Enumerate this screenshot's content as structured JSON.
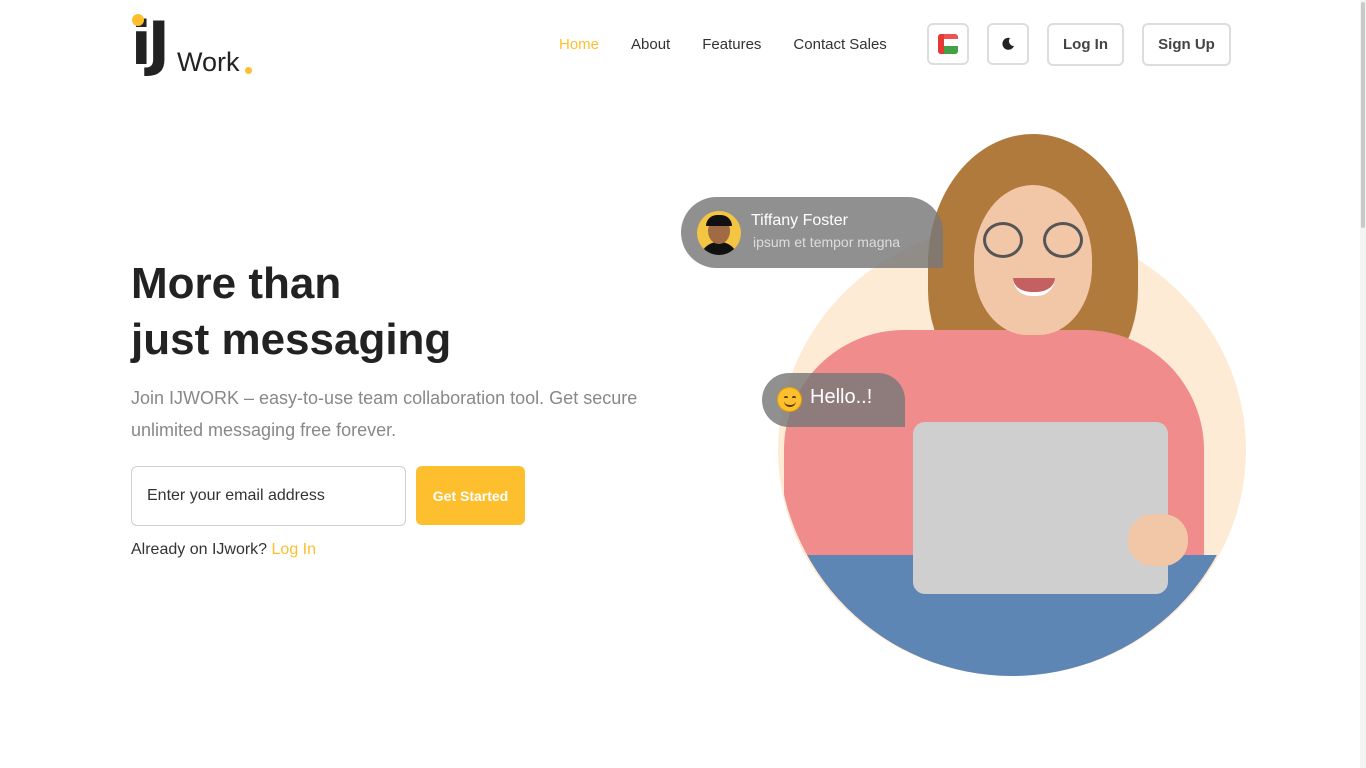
{
  "brand": {
    "mark": "iJ",
    "word": "Work",
    "accent": "#FDBF2D"
  },
  "nav": [
    {
      "label": "Home"
    },
    {
      "label": "About"
    },
    {
      "label": "Features"
    },
    {
      "label": "Contact Sales"
    }
  ],
  "header_actions": {
    "language_icon": "flag-icon",
    "theme_icon": "moon-icon",
    "login_label": "Log In",
    "signup_label": "Sign Up"
  },
  "hero": {
    "title_line1": "More than",
    "title_line2": "just messaging",
    "subtitle": "Join IJWORK – easy-to-use team collaboration tool. Get secure unlimited messaging free forever.",
    "email_placeholder": "Enter your email address",
    "cta_label": "Get Started",
    "already_text": "Already on IJwork?",
    "already_link": "Log In"
  },
  "chat": {
    "name": "Tiffany Foster",
    "message": "ipsum et tempor magna",
    "hello": "Hello..!"
  }
}
